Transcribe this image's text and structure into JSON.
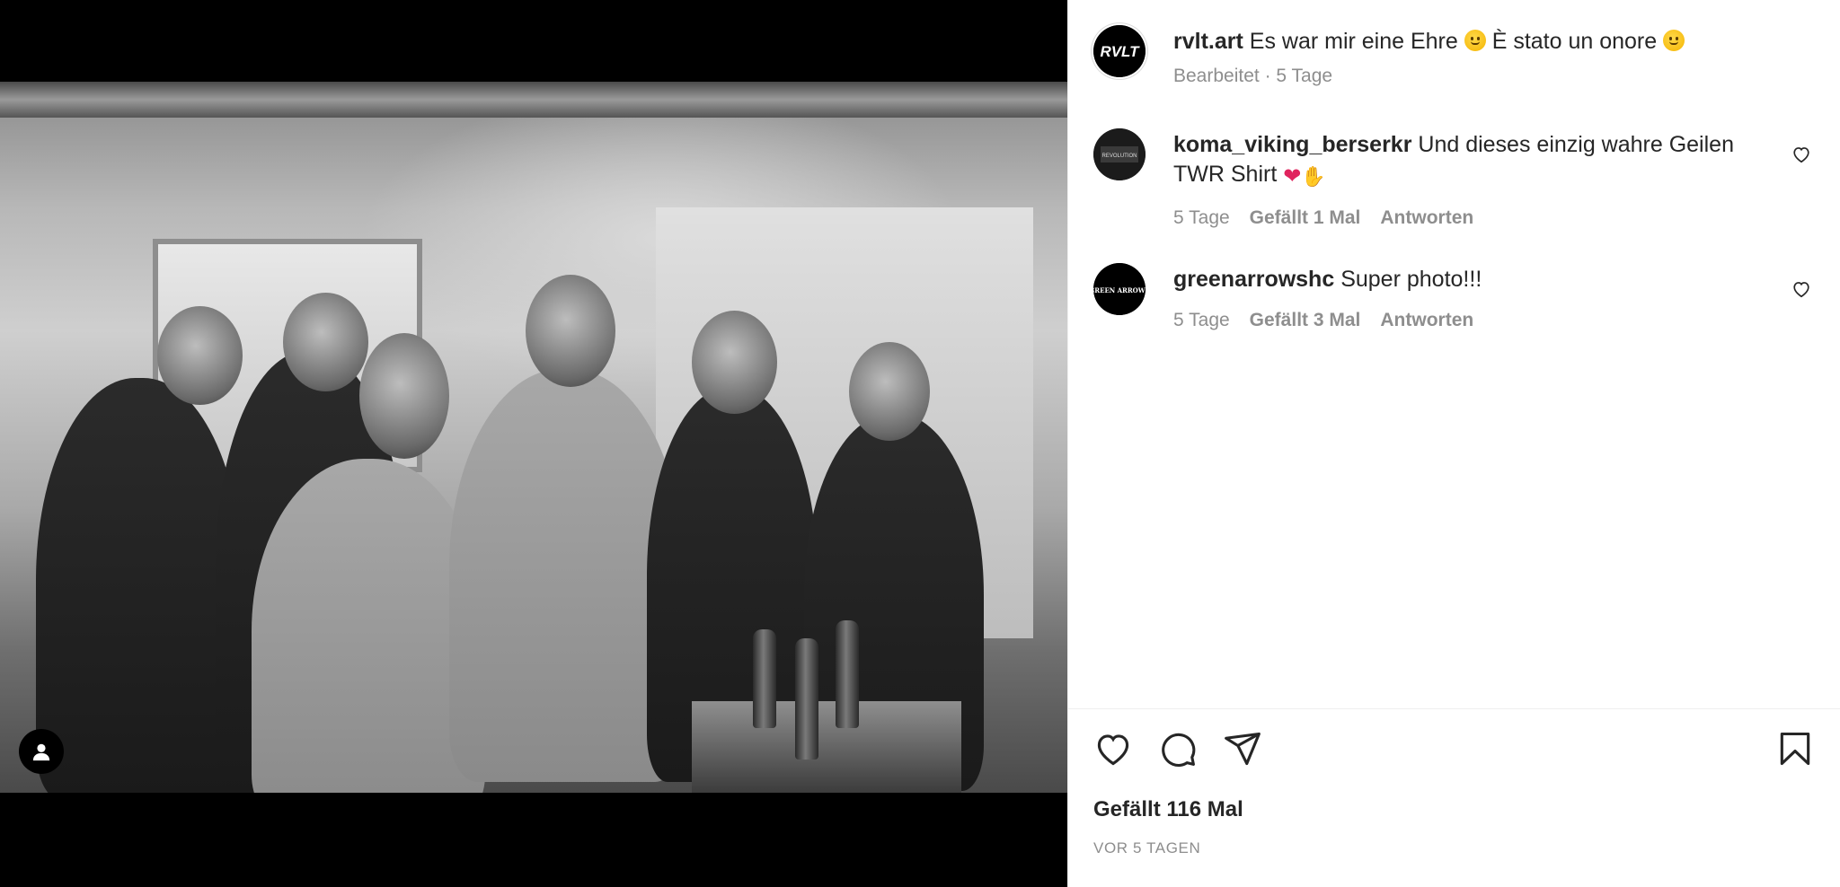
{
  "post": {
    "author": "rvlt.art",
    "caption": "Es war mir eine Ehre",
    "caption_it": "È stato un onore",
    "edited_label": "Bearbeitet",
    "meta_separator": "·",
    "time_ago": "5 Tage",
    "avatar_logo": "RVLT"
  },
  "comments": [
    {
      "username": "koma_viking_berserkr",
      "text": "Und dieses einzig wahre Geilen TWR Shirt",
      "time_ago": "5 Tage",
      "likes_label": "Gefällt 1 Mal",
      "reply_label": "Antworten",
      "avatar_logo": "REVOLUTION"
    },
    {
      "username": "greenarrowshc",
      "text": "Super photo!!!",
      "time_ago": "5 Tage",
      "likes_label": "Gefällt 3 Mal",
      "reply_label": "Antworten",
      "avatar_logo": "GREEN ARROWS"
    }
  ],
  "footer": {
    "likes_label": "Gefällt 116 Mal",
    "date_label": "VOR 5 TAGEN"
  },
  "icons": {
    "like": "heart-icon",
    "comment": "comment-bubble-icon",
    "share": "paper-plane-icon",
    "save": "bookmark-icon",
    "tag": "user-tag-icon"
  },
  "colors": {
    "text": "#262626",
    "muted": "#8e8e8e",
    "divider": "#efefef",
    "red_heart": "#e0245e"
  }
}
